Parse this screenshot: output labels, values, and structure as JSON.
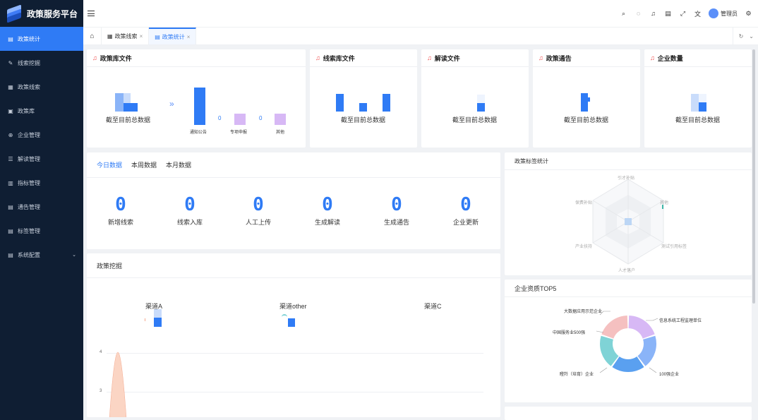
{
  "app": {
    "title": "政策服务平台"
  },
  "sidebar": {
    "items": [
      {
        "label": "政策统计",
        "icon": "doc-icon",
        "active": true
      },
      {
        "label": "线索挖掘",
        "icon": "pen-icon"
      },
      {
        "label": "政策线索",
        "icon": "grid-icon"
      },
      {
        "label": "政策库",
        "icon": "book-icon"
      },
      {
        "label": "企业管理",
        "icon": "globe-icon"
      },
      {
        "label": "解读管理",
        "icon": "list-icon"
      },
      {
        "label": "指标管理",
        "icon": "chart-icon"
      },
      {
        "label": "通告管理",
        "icon": "notice-icon"
      },
      {
        "label": "标签管理",
        "icon": "tag-icon"
      },
      {
        "label": "系统配置",
        "icon": "settings-icon",
        "has_children": true
      }
    ]
  },
  "header": {
    "user": "管理员"
  },
  "tabs": [
    {
      "label": "政策线索"
    },
    {
      "label": "政策统计",
      "active": true
    }
  ],
  "cards": {
    "policy_lib": {
      "title": "政策库文件",
      "total_label": "截至目前总数据",
      "items": [
        {
          "label": "通知公告",
          "value": ""
        },
        {
          "label": "专项申报",
          "value": "0"
        },
        {
          "label": "其他",
          "value": "0"
        }
      ]
    },
    "clue_lib": {
      "title": "线索库文件",
      "total_label": "截至目前总数据"
    },
    "interpret": {
      "title": "解读文件",
      "total_label": "截至目前总数据"
    },
    "notice": {
      "title": "政策通告",
      "total_label": "截至目前总数据"
    },
    "enterprise": {
      "title": "企业数量",
      "total_label": "截至目前总数据"
    }
  },
  "today": {
    "tabs": [
      "今日数据",
      "本周数据",
      "本月数据"
    ],
    "stats": [
      {
        "value": "0",
        "label": "新增线索"
      },
      {
        "value": "0",
        "label": "线索入库"
      },
      {
        "value": "0",
        "label": "人工上传"
      },
      {
        "value": "0",
        "label": "生成解读"
      },
      {
        "value": "0",
        "label": "生成通告"
      },
      {
        "value": "0",
        "label": "企业更新"
      }
    ]
  },
  "mining": {
    "title": "政策挖掘",
    "channels": [
      "渠道A",
      "渠道other",
      "渠道C"
    ],
    "y_ticks": [
      "4",
      "3"
    ]
  },
  "tag_stats": {
    "title": "政策标签统计",
    "axes": [
      "引才补贴",
      "其他",
      "测试引用标签",
      "人才落户",
      "产业扶持",
      "保费补贴"
    ]
  },
  "top5": {
    "title": "企业资质TOP5",
    "segments": [
      {
        "label": "信息系统工程监理单位",
        "color": "#d7b8f5"
      },
      {
        "label": "100强企业",
        "color": "#8ab4f8"
      },
      {
        "label": "瞪羚（培育）企业",
        "color": "#5aa0f0"
      },
      {
        "label": "中国服务业500强",
        "color": "#7fd3d6"
      },
      {
        "label": "大数据应用示范企业",
        "color": "#f5c0c0"
      }
    ]
  },
  "colors": {
    "accent": "#2f7bf5",
    "sidebar_bg": "#0f1e33",
    "alert": "#f04a4a"
  }
}
